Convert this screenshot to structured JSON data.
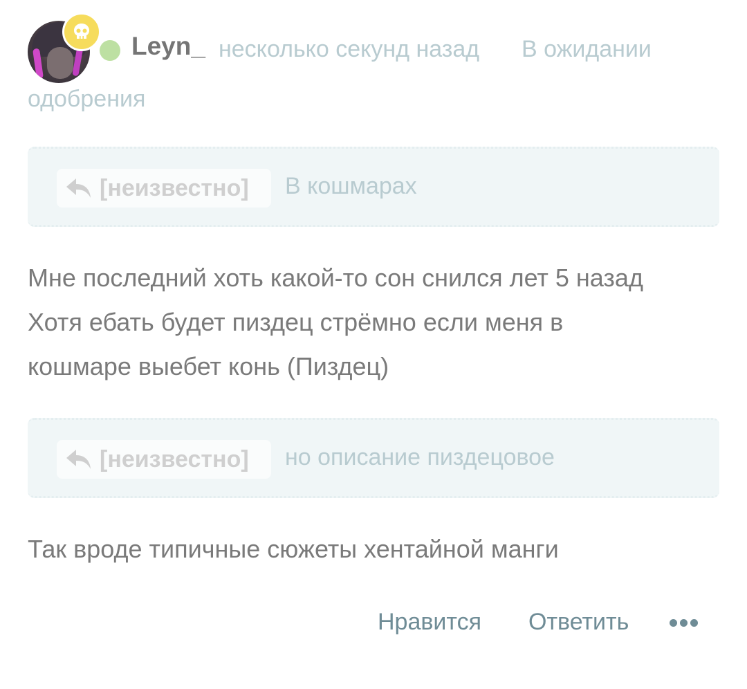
{
  "comment": {
    "username": "Leyn_",
    "timestamp": "несколько секунд назад",
    "status_line1": "В ожидании",
    "status_line2": "одобрения",
    "online_color": "#bde0a2",
    "badge_icon": "skull-icon",
    "badge_color": "#f6dc5c"
  },
  "quotes": [
    {
      "author": "[неизвестно]",
      "text": "В кошмарах"
    },
    {
      "author": "[неизвестно]",
      "text": "но описание пиздецовое"
    }
  ],
  "body_paragraph1": [
    "Мне последний хоть какой-то сон снился лет 5 назад",
    "Хотя ебать будет пиздец стрёмно если меня в",
    "кошмаре выебет конь (Пиздец)"
  ],
  "body_paragraph2": [
    "Так вроде типичные сюжеты хентайной манги"
  ],
  "actions": {
    "like_label": "Нравится",
    "reply_label": "Ответить",
    "more_icon": "more-dots-icon",
    "accent_color": "#6f8c96"
  }
}
